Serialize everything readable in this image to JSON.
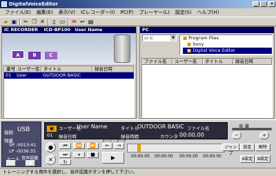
{
  "window": {
    "title": "DigitalVoiceEditor",
    "minimize": "_",
    "maximize": "□",
    "close": "×"
  },
  "menu": [
    "ファイル(E)",
    "編集(E)",
    "表示(V)",
    "ICレコーダー(I)",
    "PC(P)",
    "プレーヤー(L)",
    "設定(S)",
    "ヘルプ(H)"
  ],
  "toolbar": {
    "buttons": [
      "folder-icon",
      "save-icon",
      "cut-icon",
      "copy-icon",
      "delete-icon",
      "split-icon",
      "combine-icon",
      "mark-icon",
      "undo-icon",
      "info-icon"
    ]
  },
  "left_pane": {
    "header": "IC RECORDER",
    "model": "ICD-BP100",
    "user": "User Name",
    "folders": [
      "A",
      "B",
      "C"
    ],
    "columns": [
      "番号",
      "ユーザー名",
      "タイトル",
      "録音日時"
    ],
    "rows": [
      {
        "num": "01",
        "user": "User Name",
        "title": "OUTDOOR BASIC",
        "date": ""
      }
    ]
  },
  "right_pane": {
    "header": "PC",
    "drive": "c:",
    "tree": [
      "Program Files",
      "Sony",
      "Digital Voice Editor"
    ],
    "columns": [
      "ファイル名",
      "ユーザー名",
      "タイトル",
      "録音日時"
    ]
  },
  "control": {
    "connection_label": "接続",
    "connection_value": "USB",
    "remaining_label": "残量",
    "sp_time": "SP -0013:41",
    "lp_time": "LP -0036:35",
    "mail_label": "メール",
    "voice_label": "音声認識",
    "num": "01",
    "user_label": "ユーザー名",
    "user_value": "User Name",
    "title_label": "タイトル",
    "title_value": "OUTDOOR BASIC",
    "file_label": "ファイル名",
    "record_date_label": "録音日時",
    "record_time_label": "録音時間",
    "count_label": "カウンタ",
    "count_value": "00:00.00",
    "mark_label": "ビージ・マーク",
    "time_marks": [
      "00:00.00",
      "00:00.00",
      "00:00.00",
      "00:00.00"
    ],
    "volume_label": "音 量",
    "jump_label": "ジャンプ",
    "set_label": "設定",
    "clear_label": "解除",
    "a_label": "A設定",
    "b_label": "B設定"
  },
  "status": "トレーニングする用件を選択し、音声認識ボタンを押して下さい。"
}
